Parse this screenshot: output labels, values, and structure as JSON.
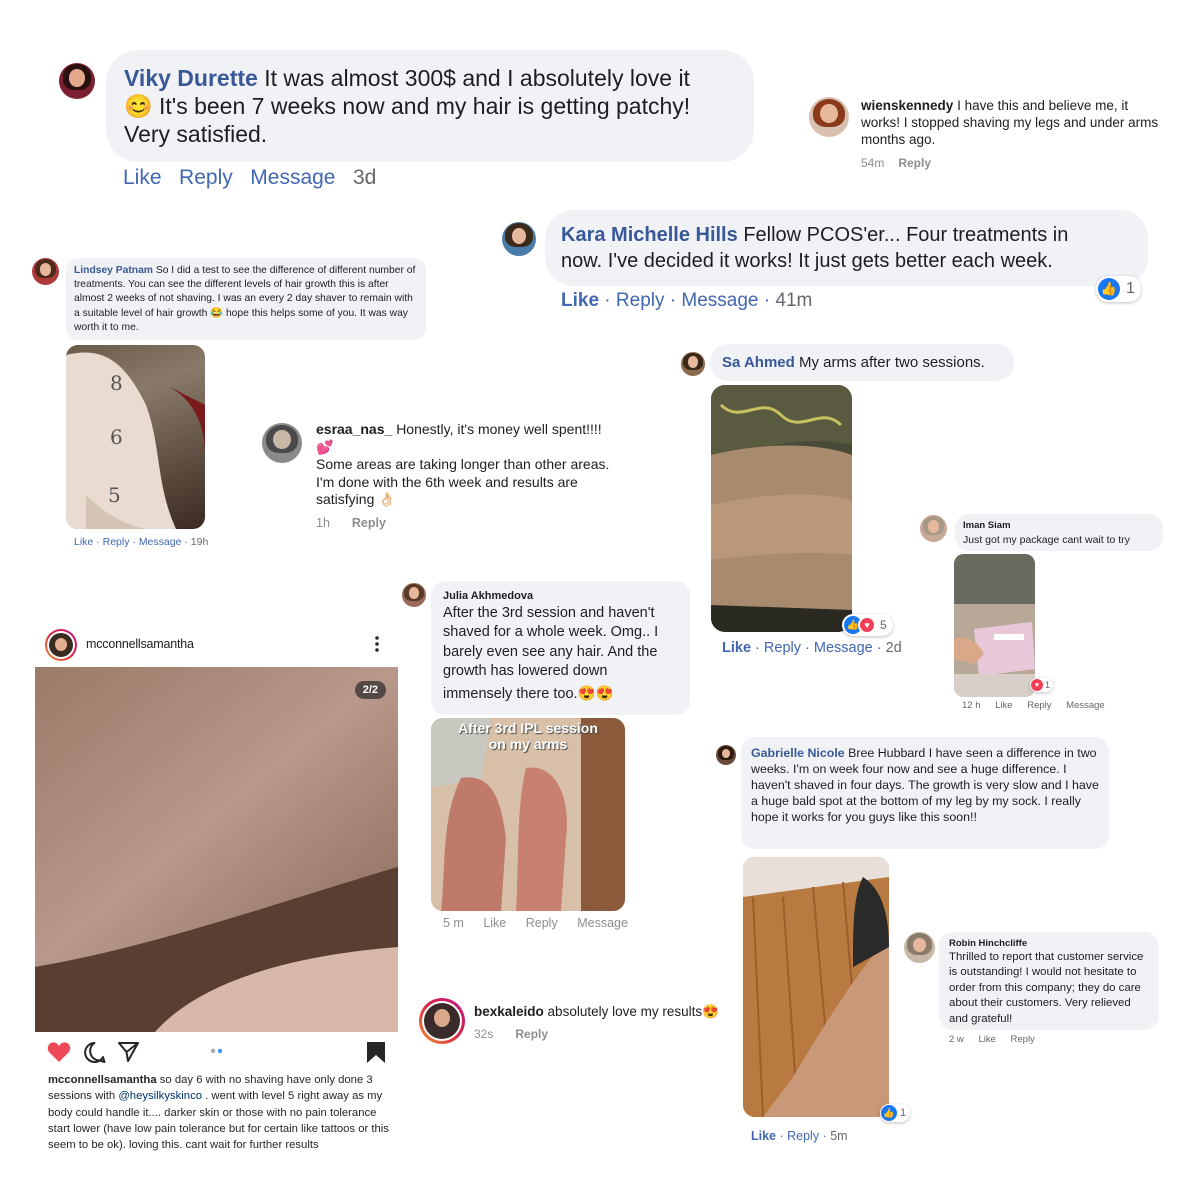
{
  "comments": {
    "viky": {
      "name": "Viky Durette",
      "text_line1": "It was almost 300$ and I absolutely love it",
      "emoji": "😊",
      "text_line2": "It's been 7 weeks now and my hair is getting patchy!",
      "text_line3": "Very satisfied.",
      "like": "Like",
      "reply": "Reply",
      "message": "Message",
      "time": "3d"
    },
    "wienskennedy": {
      "name": "wienskennedy",
      "text": "I have this and believe me, it works!  I stopped shaving my legs and under arms months ago.",
      "time": "54m",
      "reply": "Reply"
    },
    "kara": {
      "name": "Kara Michelle Hills",
      "text_line1": "Fellow PCOS'er... Four treatments in",
      "text_line2": "now. I've decided it works! It just gets better each week.",
      "like": "Like",
      "reply": "Reply",
      "message": "Message",
      "time": "41m",
      "reaction_count": "1"
    },
    "lindsey": {
      "name": "Lindsey Patnam",
      "text": "So I did a test to see the difference of different number of treatments. You can see the different levels of hair growth this is after almost 2 weeks of not shaving. I was an every 2 day shaver to remain with a suitable level of hair growth",
      "emoji": "😂",
      "text_end": "hope this helps some of you. It was way worth it to me.",
      "like": "Like",
      "reply": "Reply",
      "message": "Message",
      "time": "19h",
      "photo_marks": [
        "8",
        "6",
        "5"
      ]
    },
    "sa_ahmed": {
      "name": "Sa Ahmed",
      "text": "My arms after two sessions.",
      "like": "Like",
      "reply": "Reply",
      "message": "Message",
      "time": "2d",
      "reaction_count": "5"
    },
    "esraa": {
      "name": "esraa_nas_",
      "text_line1": "Honestly, it's money well spent!!!!",
      "emoji1": "💕",
      "text_line2": "Some areas are taking longer than other areas.",
      "text_line3": "I'm done with the 6th week and results are",
      "text_line4": "satisfying",
      "emoji2": "👌🏻",
      "time": "1h",
      "reply": "Reply"
    },
    "iman": {
      "name": "Iman Siam",
      "text": "Just got my package cant wait to try",
      "time": "12 h",
      "like": "Like",
      "reply": "Reply",
      "message": "Message",
      "reaction_count": "1"
    },
    "julia": {
      "name": "Julia Akhmedova",
      "text_line1": "After the 3rd session and haven't",
      "text_line2": "shaved for a whole week.  Omg.. I",
      "text_line3": "barely even see any hair.  And the",
      "text_line4": "growth has lowered down",
      "text_line5": "immensely there too.",
      "emoji": "😍😍",
      "photo_caption1": "After 3rd IPL session",
      "photo_caption2": "on my arms",
      "time": "5 m",
      "like": "Like",
      "reply": "Reply",
      "message": "Message"
    },
    "gabrielle": {
      "name": "Gabrielle Nicole",
      "text": "Bree Hubbard I have seen a difference in two weeks. I'm on week four now and see a huge difference. I haven't shaved in four days. The growth is very slow and I have a huge bald spot at the bottom of my leg by my sock. I really hope it works for you guys like this soon!!",
      "like": "Like",
      "reply": "Reply",
      "time": "5m",
      "reaction_count": "1"
    },
    "robin": {
      "name": "Robin Hinchcliffe",
      "text": "Thrilled to report that customer service is outstanding!  I would not hesitate to order from this company; they do care about their customers. Very relieved and grateful!",
      "time": "2 w",
      "like": "Like",
      "reply": "Reply"
    },
    "bexkaleido": {
      "name": "bexkaleido",
      "text": "absolutely love my results",
      "emoji": "😍",
      "time": "32s",
      "reply": "Reply"
    }
  },
  "instagram_post": {
    "username": "mcconnellsamantha",
    "more_icon": "more-vertical-icon",
    "counter": "2/2",
    "caption_user": "mcconnellsamantha",
    "caption_part1": "so day 6 with no shaving have only done 3 sessions with",
    "mention": "@heysilkyskinco",
    "caption_part2": ". went with level 5 right away as my body could handle it.... darker skin or those with no pain tolerance start lower (have low pain tolerance but for certain like tattoos or this seem to be ok). loving this. cant wait for further results",
    "icons": [
      "heart-icon",
      "comment-icon",
      "share-icon",
      "bookmark-icon"
    ]
  },
  "colors": {
    "fb_blue": "#385898",
    "link_blue": "#4267b2",
    "bubble_gray": "#f0f2f5",
    "heart_red": "#ed4956"
  }
}
